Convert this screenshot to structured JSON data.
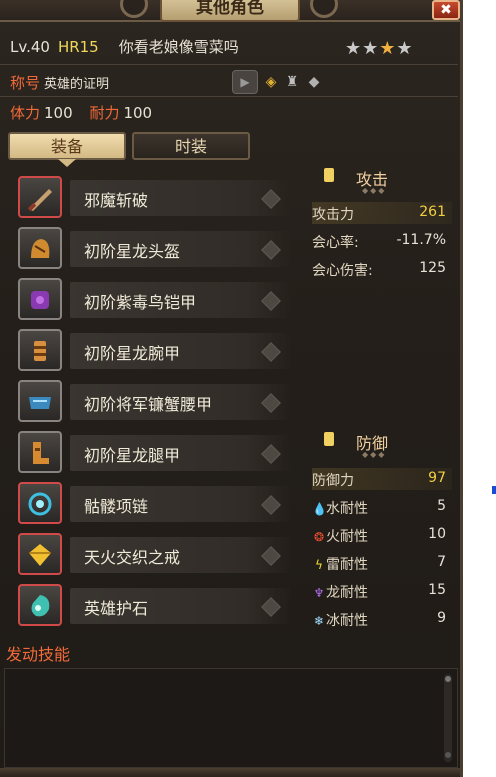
{
  "window": {
    "title": "其他角色",
    "close_label": "✖"
  },
  "player": {
    "level": "Lv.40",
    "hr": "HR15",
    "nickname": "你看老娘像雪菜吗",
    "stars": [
      "★",
      "★",
      "★",
      "★"
    ],
    "title_label": "称号",
    "title_value": "英雄的证明",
    "stamina_label": "体力",
    "stamina_value": "100",
    "endurance_label": "耐力",
    "endurance_value": "100"
  },
  "tabs": [
    {
      "label": "装备",
      "active": true
    },
    {
      "label": "时装",
      "active": false
    }
  ],
  "equipment": [
    {
      "name": "邪魔斩破",
      "icon": "weapon-icon",
      "frame": "red"
    },
    {
      "name": "初阶星龙头盔",
      "icon": "helmet-icon",
      "frame": "gray"
    },
    {
      "name": "初阶紫毒鸟铠甲",
      "icon": "chest-armor-icon",
      "frame": "gray"
    },
    {
      "name": "初阶星龙腕甲",
      "icon": "gauntlet-icon",
      "frame": "gray"
    },
    {
      "name": "初阶将军镰蟹腰甲",
      "icon": "waist-armor-icon",
      "frame": "gray"
    },
    {
      "name": "初阶星龙腿甲",
      "icon": "leg-armor-icon",
      "frame": "gray"
    },
    {
      "name": "骷髅项链",
      "icon": "necklace-icon",
      "frame": "red"
    },
    {
      "name": "天火交织之戒",
      "icon": "ring-icon",
      "frame": "red"
    },
    {
      "name": "英雄护石",
      "icon": "charm-icon",
      "frame": "red"
    }
  ],
  "attack": {
    "title": "攻击",
    "rows": [
      {
        "label": "攻击力",
        "value": "261"
      },
      {
        "label": "会心率:",
        "value": "-11.7%"
      },
      {
        "label": "会心伤害:",
        "value": "125"
      }
    ]
  },
  "defense": {
    "title": "防御",
    "rows": [
      {
        "label": "防御力",
        "value": "97",
        "icon": ""
      },
      {
        "label": "水耐性",
        "value": "5",
        "icon": "water-icon"
      },
      {
        "label": "火耐性",
        "value": "10",
        "icon": "fire-icon"
      },
      {
        "label": "雷耐性",
        "value": "7",
        "icon": "thunder-icon"
      },
      {
        "label": "龙耐性",
        "value": "15",
        "icon": "dragon-icon"
      },
      {
        "label": "冰耐性",
        "value": "9",
        "icon": "ice-icon"
      }
    ]
  },
  "skills": {
    "title": "发动技能"
  },
  "colors": {
    "accent_red": "#f06a3a",
    "hr_gold": "#f0d85a",
    "panel_bg": "#241f1a"
  }
}
